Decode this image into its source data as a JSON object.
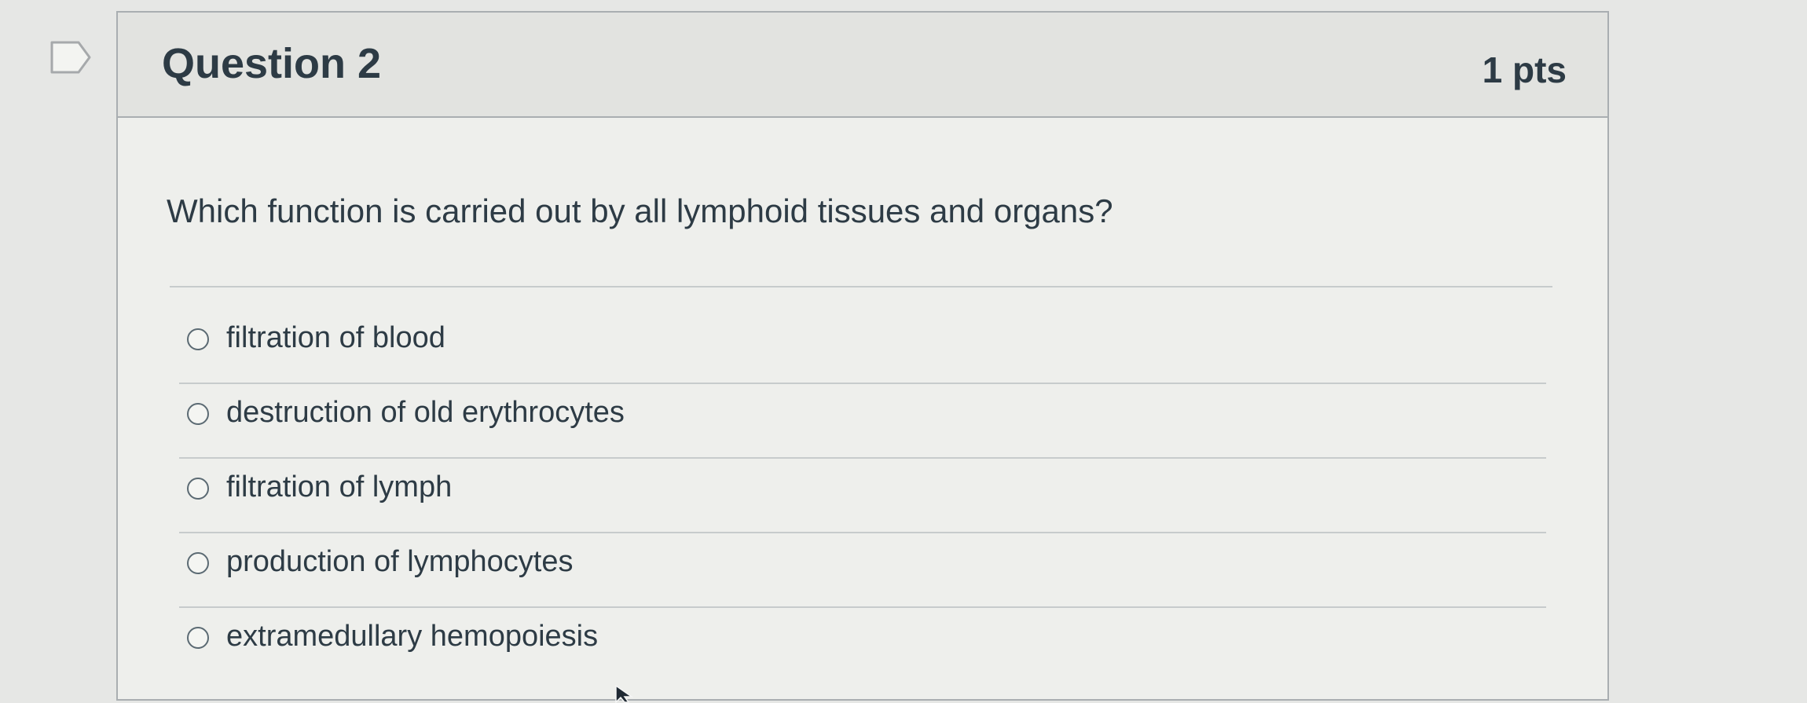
{
  "question": {
    "title": "Question 2",
    "points": "1 pts",
    "text": "Which function is carried out by all lymphoid tissues and organs?",
    "answers": [
      {
        "label": "filtration of blood",
        "selected": false
      },
      {
        "label": "destruction of old erythrocytes",
        "selected": false
      },
      {
        "label": "filtration of lymph",
        "selected": false
      },
      {
        "label": "production of lymphocytes",
        "selected": false
      },
      {
        "label": "extramedullary hemopoiesis",
        "selected": false
      }
    ]
  },
  "icons": {
    "flag": "flag-question-icon",
    "radio": "radio-button-icon",
    "cursor": "mouse-cursor-icon"
  },
  "colors": {
    "background": "#e6e7e5",
    "card": "#eeefec",
    "header": "#e2e3e0",
    "text": "#2d3b45",
    "border": "#a9aeb1"
  }
}
